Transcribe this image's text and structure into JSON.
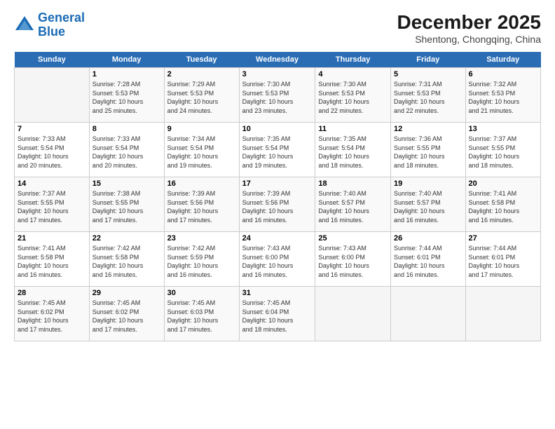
{
  "logo": {
    "line1": "General",
    "line2": "Blue"
  },
  "title": "December 2025",
  "subtitle": "Shentong, Chongqing, China",
  "days_header": [
    "Sunday",
    "Monday",
    "Tuesday",
    "Wednesday",
    "Thursday",
    "Friday",
    "Saturday"
  ],
  "weeks": [
    [
      {
        "num": "",
        "info": ""
      },
      {
        "num": "1",
        "info": "Sunrise: 7:28 AM\nSunset: 5:53 PM\nDaylight: 10 hours\nand 25 minutes."
      },
      {
        "num": "2",
        "info": "Sunrise: 7:29 AM\nSunset: 5:53 PM\nDaylight: 10 hours\nand 24 minutes."
      },
      {
        "num": "3",
        "info": "Sunrise: 7:30 AM\nSunset: 5:53 PM\nDaylight: 10 hours\nand 23 minutes."
      },
      {
        "num": "4",
        "info": "Sunrise: 7:30 AM\nSunset: 5:53 PM\nDaylight: 10 hours\nand 22 minutes."
      },
      {
        "num": "5",
        "info": "Sunrise: 7:31 AM\nSunset: 5:53 PM\nDaylight: 10 hours\nand 22 minutes."
      },
      {
        "num": "6",
        "info": "Sunrise: 7:32 AM\nSunset: 5:53 PM\nDaylight: 10 hours\nand 21 minutes."
      }
    ],
    [
      {
        "num": "7",
        "info": "Sunrise: 7:33 AM\nSunset: 5:54 PM\nDaylight: 10 hours\nand 20 minutes."
      },
      {
        "num": "8",
        "info": "Sunrise: 7:33 AM\nSunset: 5:54 PM\nDaylight: 10 hours\nand 20 minutes."
      },
      {
        "num": "9",
        "info": "Sunrise: 7:34 AM\nSunset: 5:54 PM\nDaylight: 10 hours\nand 19 minutes."
      },
      {
        "num": "10",
        "info": "Sunrise: 7:35 AM\nSunset: 5:54 PM\nDaylight: 10 hours\nand 19 minutes."
      },
      {
        "num": "11",
        "info": "Sunrise: 7:35 AM\nSunset: 5:54 PM\nDaylight: 10 hours\nand 18 minutes."
      },
      {
        "num": "12",
        "info": "Sunrise: 7:36 AM\nSunset: 5:55 PM\nDaylight: 10 hours\nand 18 minutes."
      },
      {
        "num": "13",
        "info": "Sunrise: 7:37 AM\nSunset: 5:55 PM\nDaylight: 10 hours\nand 18 minutes."
      }
    ],
    [
      {
        "num": "14",
        "info": "Sunrise: 7:37 AM\nSunset: 5:55 PM\nDaylight: 10 hours\nand 17 minutes."
      },
      {
        "num": "15",
        "info": "Sunrise: 7:38 AM\nSunset: 5:55 PM\nDaylight: 10 hours\nand 17 minutes."
      },
      {
        "num": "16",
        "info": "Sunrise: 7:39 AM\nSunset: 5:56 PM\nDaylight: 10 hours\nand 17 minutes."
      },
      {
        "num": "17",
        "info": "Sunrise: 7:39 AM\nSunset: 5:56 PM\nDaylight: 10 hours\nand 16 minutes."
      },
      {
        "num": "18",
        "info": "Sunrise: 7:40 AM\nSunset: 5:57 PM\nDaylight: 10 hours\nand 16 minutes."
      },
      {
        "num": "19",
        "info": "Sunrise: 7:40 AM\nSunset: 5:57 PM\nDaylight: 10 hours\nand 16 minutes."
      },
      {
        "num": "20",
        "info": "Sunrise: 7:41 AM\nSunset: 5:58 PM\nDaylight: 10 hours\nand 16 minutes."
      }
    ],
    [
      {
        "num": "21",
        "info": "Sunrise: 7:41 AM\nSunset: 5:58 PM\nDaylight: 10 hours\nand 16 minutes."
      },
      {
        "num": "22",
        "info": "Sunrise: 7:42 AM\nSunset: 5:58 PM\nDaylight: 10 hours\nand 16 minutes."
      },
      {
        "num": "23",
        "info": "Sunrise: 7:42 AM\nSunset: 5:59 PM\nDaylight: 10 hours\nand 16 minutes."
      },
      {
        "num": "24",
        "info": "Sunrise: 7:43 AM\nSunset: 6:00 PM\nDaylight: 10 hours\nand 16 minutes."
      },
      {
        "num": "25",
        "info": "Sunrise: 7:43 AM\nSunset: 6:00 PM\nDaylight: 10 hours\nand 16 minutes."
      },
      {
        "num": "26",
        "info": "Sunrise: 7:44 AM\nSunset: 6:01 PM\nDaylight: 10 hours\nand 16 minutes."
      },
      {
        "num": "27",
        "info": "Sunrise: 7:44 AM\nSunset: 6:01 PM\nDaylight: 10 hours\nand 17 minutes."
      }
    ],
    [
      {
        "num": "28",
        "info": "Sunrise: 7:45 AM\nSunset: 6:02 PM\nDaylight: 10 hours\nand 17 minutes."
      },
      {
        "num": "29",
        "info": "Sunrise: 7:45 AM\nSunset: 6:02 PM\nDaylight: 10 hours\nand 17 minutes."
      },
      {
        "num": "30",
        "info": "Sunrise: 7:45 AM\nSunset: 6:03 PM\nDaylight: 10 hours\nand 17 minutes."
      },
      {
        "num": "31",
        "info": "Sunrise: 7:45 AM\nSunset: 6:04 PM\nDaylight: 10 hours\nand 18 minutes."
      },
      {
        "num": "",
        "info": ""
      },
      {
        "num": "",
        "info": ""
      },
      {
        "num": "",
        "info": ""
      }
    ]
  ]
}
